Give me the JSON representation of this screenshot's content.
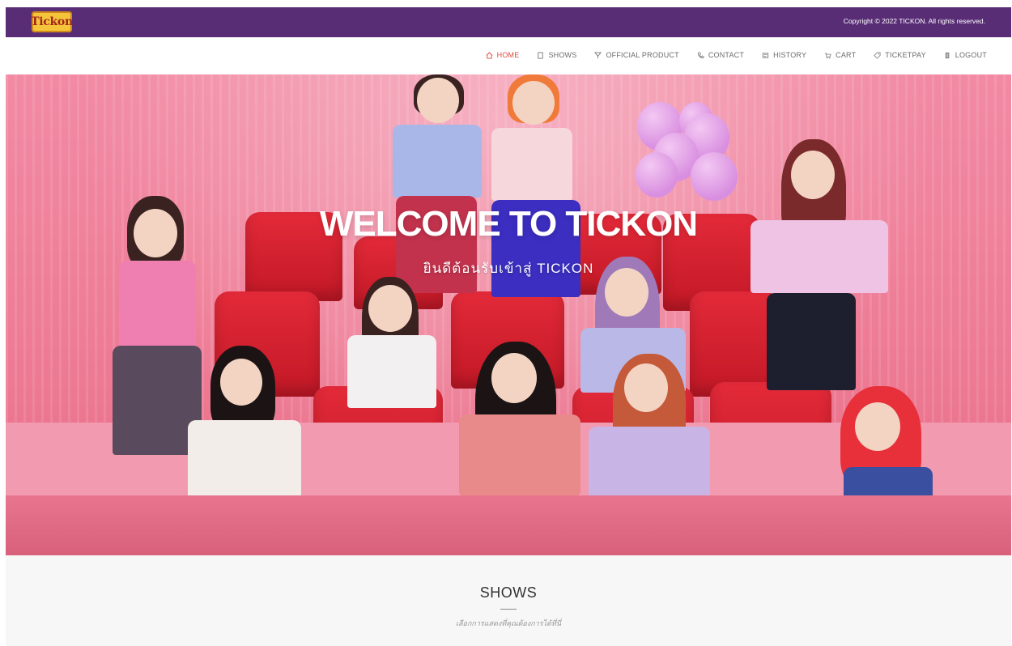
{
  "brand": {
    "logo_text": "Tickon",
    "color": "#582d75"
  },
  "topbar": {
    "copyright": "Copyright © 2022 TICKON. All rights reserved."
  },
  "nav": {
    "items": [
      {
        "label": "HOME",
        "icon": "home-icon",
        "active": true
      },
      {
        "label": "SHOWS",
        "icon": "ticket-icon"
      },
      {
        "label": "OFFICIAL PRODUCT",
        "icon": "tag-icon"
      },
      {
        "label": "CONTACT",
        "icon": "phone-icon"
      },
      {
        "label": "HISTORY",
        "icon": "history-icon"
      },
      {
        "label": "CART",
        "icon": "cart-icon"
      },
      {
        "label": "TICKETPAY",
        "icon": "ticketpay-icon"
      },
      {
        "label": "LOGOUT",
        "icon": "logout-icon"
      }
    ],
    "active_color": "#e0473a"
  },
  "hero": {
    "title": "WELCOME TO TICKON",
    "subtitle": "ยินดีต้อนรับเข้าสู่ TICKON"
  },
  "shows": {
    "title": "SHOWS",
    "subtitle": "เลือกการแสดงที่คุณต้องการได้ที่นี่"
  }
}
